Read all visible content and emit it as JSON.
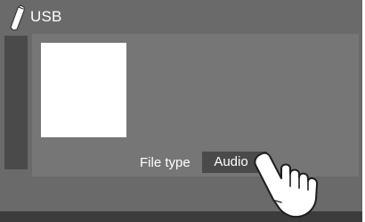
{
  "header": {
    "title": "USB",
    "icon": "usb-stick-icon"
  },
  "player": {
    "artwork": "blank-album-artwork",
    "file_type": {
      "label": "File type",
      "value": "Audio"
    }
  },
  "overlay": {
    "icon": "tap-hand-icon"
  },
  "colors": {
    "background": "#6a6a6a",
    "panel": "#767676",
    "button": "#4a4a4a",
    "text": "#ffffff"
  }
}
